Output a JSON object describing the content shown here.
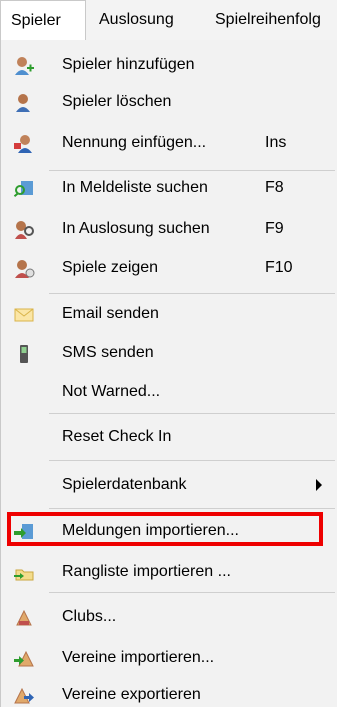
{
  "menubar": {
    "spieler": "Spieler",
    "auslosung": "Auslosung",
    "spielreihenfolge": "Spielreihenfolg"
  },
  "menu": {
    "spieler_hinzufuegen": "Spieler hinzufügen",
    "spieler_loeschen": "Spieler löschen",
    "nennung_einfuegen": "Nennung einfügen...",
    "nennung_einfuegen_shortcut": "Ins",
    "in_meldeliste_suchen": "In Meldeliste suchen",
    "in_meldeliste_suchen_shortcut": "F8",
    "in_auslosung_suchen": "In Auslosung suchen",
    "in_auslosung_suchen_shortcut": "F9",
    "spiele_zeigen": "Spiele zeigen",
    "spiele_zeigen_shortcut": "F10",
    "email_senden": "Email senden",
    "sms_senden": "SMS senden",
    "not_warned": "Not Warned...",
    "reset_check_in": "Reset Check In",
    "spielerdatenbank": "Spielerdatenbank",
    "meldungen_importieren": "Meldungen importieren...",
    "rangliste_importieren": "Rangliste importieren ...",
    "clubs": "Clubs...",
    "vereine_importieren": "Vereine importieren...",
    "vereine_exportieren": "Vereine exportieren"
  },
  "colors": {
    "highlight": "#ee0000",
    "menu_background": "#f2f2f2"
  }
}
